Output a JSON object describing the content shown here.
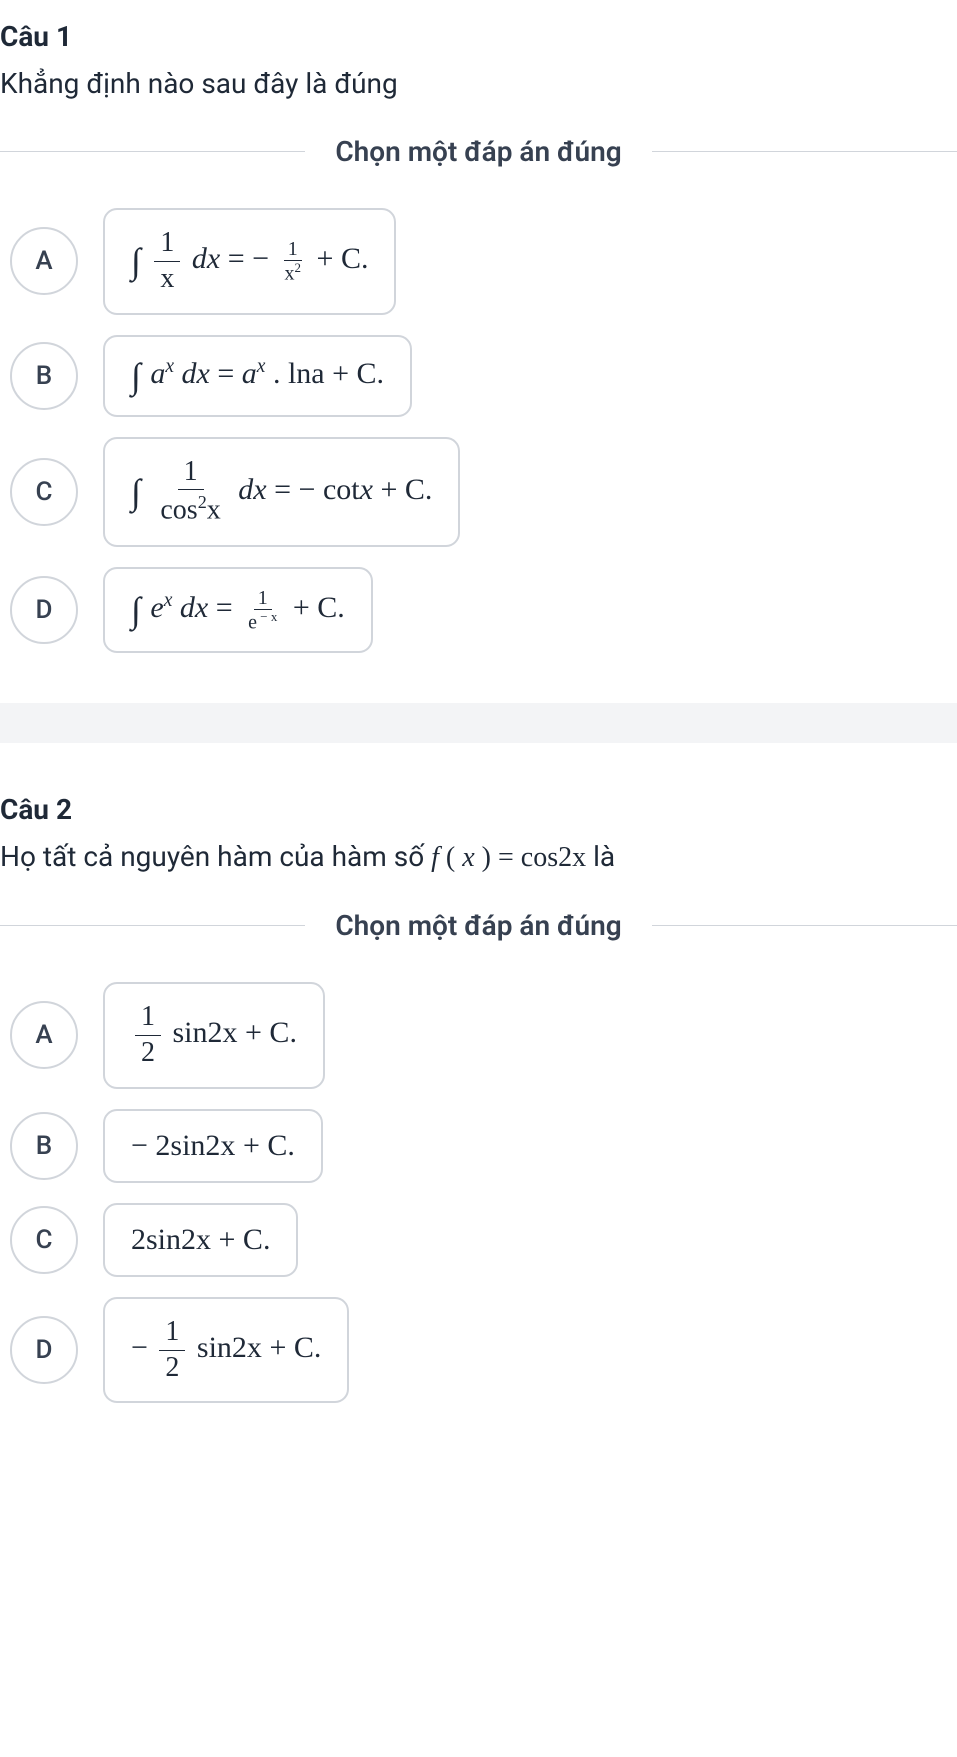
{
  "q1": {
    "number": "Câu 1",
    "prompt": "Khẳng định nào sau đây là đúng",
    "instruction": "Chọn một đáp án đúng",
    "options": {
      "A": {
        "letter": "A"
      },
      "B": {
        "letter": "B"
      },
      "C": {
        "letter": "C"
      },
      "D": {
        "letter": "D"
      }
    },
    "math": {
      "A_int": "∫",
      "A_frac_num": "1",
      "A_frac_den_var": "x",
      "A_dx": "dx",
      "A_eq": " = ",
      "A_neg": "− ",
      "A_rhs_num": "1",
      "A_rhs_den_var": "x",
      "A_rhs_den_exp": "2",
      "A_plus_c": " + C.",
      "B_int": "∫",
      "B_ax_base": "a",
      "B_ax_exp": "x",
      "B_dx": "dx",
      "B_eq": " = ",
      "B_rhs_base": "a",
      "B_rhs_exp": "x",
      "B_dot_lna": " . lna",
      "B_plus_c": " + C.",
      "C_int": "∫",
      "C_frac_num": "1",
      "C_cos": "cos",
      "C_cos_exp": "2",
      "C_cos_arg": "x",
      "C_dx": "dx",
      "C_eq": " = ",
      "C_neg_cot": "− cot",
      "C_cot_arg": "x",
      "C_plus_c": " + C.",
      "D_int": "∫",
      "D_e_base": "e",
      "D_e_exp": "x",
      "D_dx": "dx",
      "D_eq": " = ",
      "D_rhs_num": "1",
      "D_rhs_den_base": "e",
      "D_rhs_den_exp": " − x",
      "D_plus_c": " + C."
    }
  },
  "q2": {
    "number": "Câu 2",
    "prompt_pre": "Họ tất cả nguyên hàm của hàm số ",
    "prompt_math_f": "f",
    "prompt_math_paren_open": " ( ",
    "prompt_math_x": "x",
    "prompt_math_paren_close": " ) ",
    "prompt_math_eq": " = ",
    "prompt_math_cos": "cos",
    "prompt_math_2x": "2x",
    "prompt_post": " là",
    "instruction": "Chọn một đáp án đúng",
    "options": {
      "A": {
        "letter": "A"
      },
      "B": {
        "letter": "B"
      },
      "C": {
        "letter": "C"
      },
      "D": {
        "letter": "D"
      }
    },
    "math": {
      "A_frac_num": "1",
      "A_frac_den": "2",
      "A_sin2x": "sin2x",
      "A_plus_c": " + C.",
      "B_neg2": "− 2",
      "B_sin2x": "sin2x",
      "B_plus_c": " + C.",
      "C_2": "2",
      "C_sin2x": "sin2x",
      "C_plus_c": " + C.",
      "D_neg": "− ",
      "D_frac_num": "1",
      "D_frac_den": "2",
      "D_sin2x": "sin2x",
      "D_plus_c": " + C."
    }
  },
  "chart_data": {
    "type": "table",
    "description": "Two multiple-choice math questions about integrals and antiderivatives",
    "questions": [
      {
        "id": 1,
        "prompt": "Which statement is correct (about integrals)",
        "options": [
          {
            "label": "A",
            "formula": "∫(1/x)dx = -1/x² + C"
          },
          {
            "label": "B",
            "formula": "∫aˣdx = aˣ·lna + C"
          },
          {
            "label": "C",
            "formula": "∫(1/cos²x)dx = -cotx + C"
          },
          {
            "label": "D",
            "formula": "∫eˣdx = 1/e⁻ˣ + C"
          }
        ]
      },
      {
        "id": 2,
        "prompt": "Family of all antiderivatives of f(x)=cos2x",
        "options": [
          {
            "label": "A",
            "formula": "(1/2)sin2x + C"
          },
          {
            "label": "B",
            "formula": "-2sin2x + C"
          },
          {
            "label": "C",
            "formula": "2sin2x + C"
          },
          {
            "label": "D",
            "formula": "-(1/2)sin2x + C"
          }
        ]
      }
    ]
  }
}
